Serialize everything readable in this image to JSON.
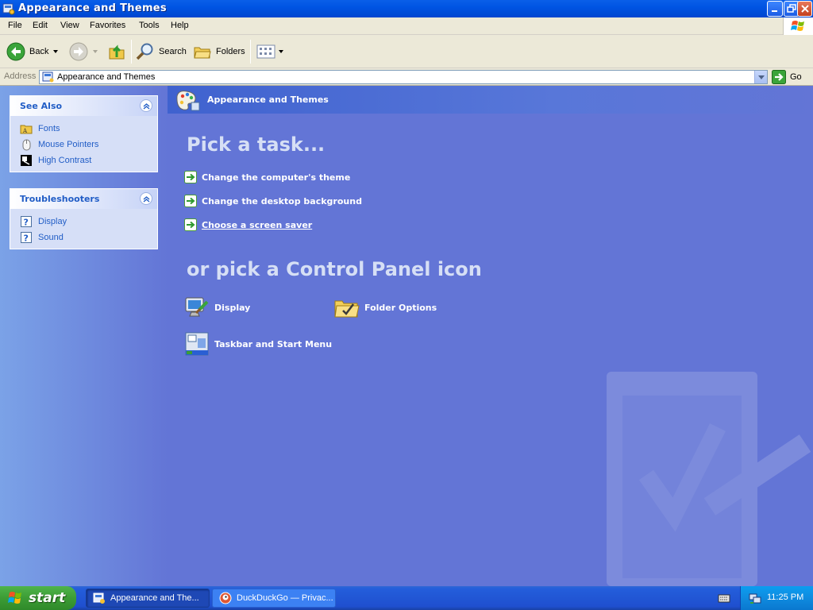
{
  "window": {
    "title": "Appearance and Themes",
    "icon": "control-panel-icon"
  },
  "menu": {
    "items": [
      "File",
      "Edit",
      "View",
      "Favorites",
      "Tools",
      "Help"
    ]
  },
  "toolbar": {
    "back_label": "Back",
    "search_label": "Search",
    "folders_label": "Folders"
  },
  "address": {
    "label": "Address",
    "value": "Appearance and Themes",
    "go_label": "Go"
  },
  "sidebar": {
    "see_also": {
      "title": "See Also",
      "items": [
        {
          "label": "Fonts",
          "icon": "fonts-folder-icon"
        },
        {
          "label": "Mouse Pointers",
          "icon": "mouse-icon"
        },
        {
          "label": "High Contrast",
          "icon": "high-contrast-icon"
        }
      ]
    },
    "troubleshooters": {
      "title": "Troubleshooters",
      "items": [
        {
          "label": "Display",
          "icon": "help-icon"
        },
        {
          "label": "Sound",
          "icon": "help-icon"
        }
      ]
    }
  },
  "main": {
    "header_title": "Appearance and Themes",
    "pick_task_heading": "Pick a task...",
    "tasks": [
      {
        "label": "Change the computer's theme"
      },
      {
        "label": "Change the desktop background"
      },
      {
        "label": "Choose a screen saver",
        "hovered": true
      }
    ],
    "pick_icon_heading": "or pick a Control Panel icon",
    "icons": [
      {
        "label": "Display",
        "icon": "display-icon"
      },
      {
        "label": "Folder Options",
        "icon": "folder-options-icon"
      },
      {
        "label": "Taskbar and Start Menu",
        "icon": "taskbar-icon"
      }
    ]
  },
  "taskbar": {
    "start_label": "start",
    "buttons": [
      {
        "label": "Appearance and The...",
        "active": true
      },
      {
        "label": "DuckDuckGo — Privac...",
        "active": false
      }
    ],
    "clock": "11:25 PM"
  },
  "colors": {
    "title_bar": "#0054e3",
    "content_bg": "#6375d6",
    "link_blue": "#215dc6",
    "start_green": "#3c9c35"
  }
}
